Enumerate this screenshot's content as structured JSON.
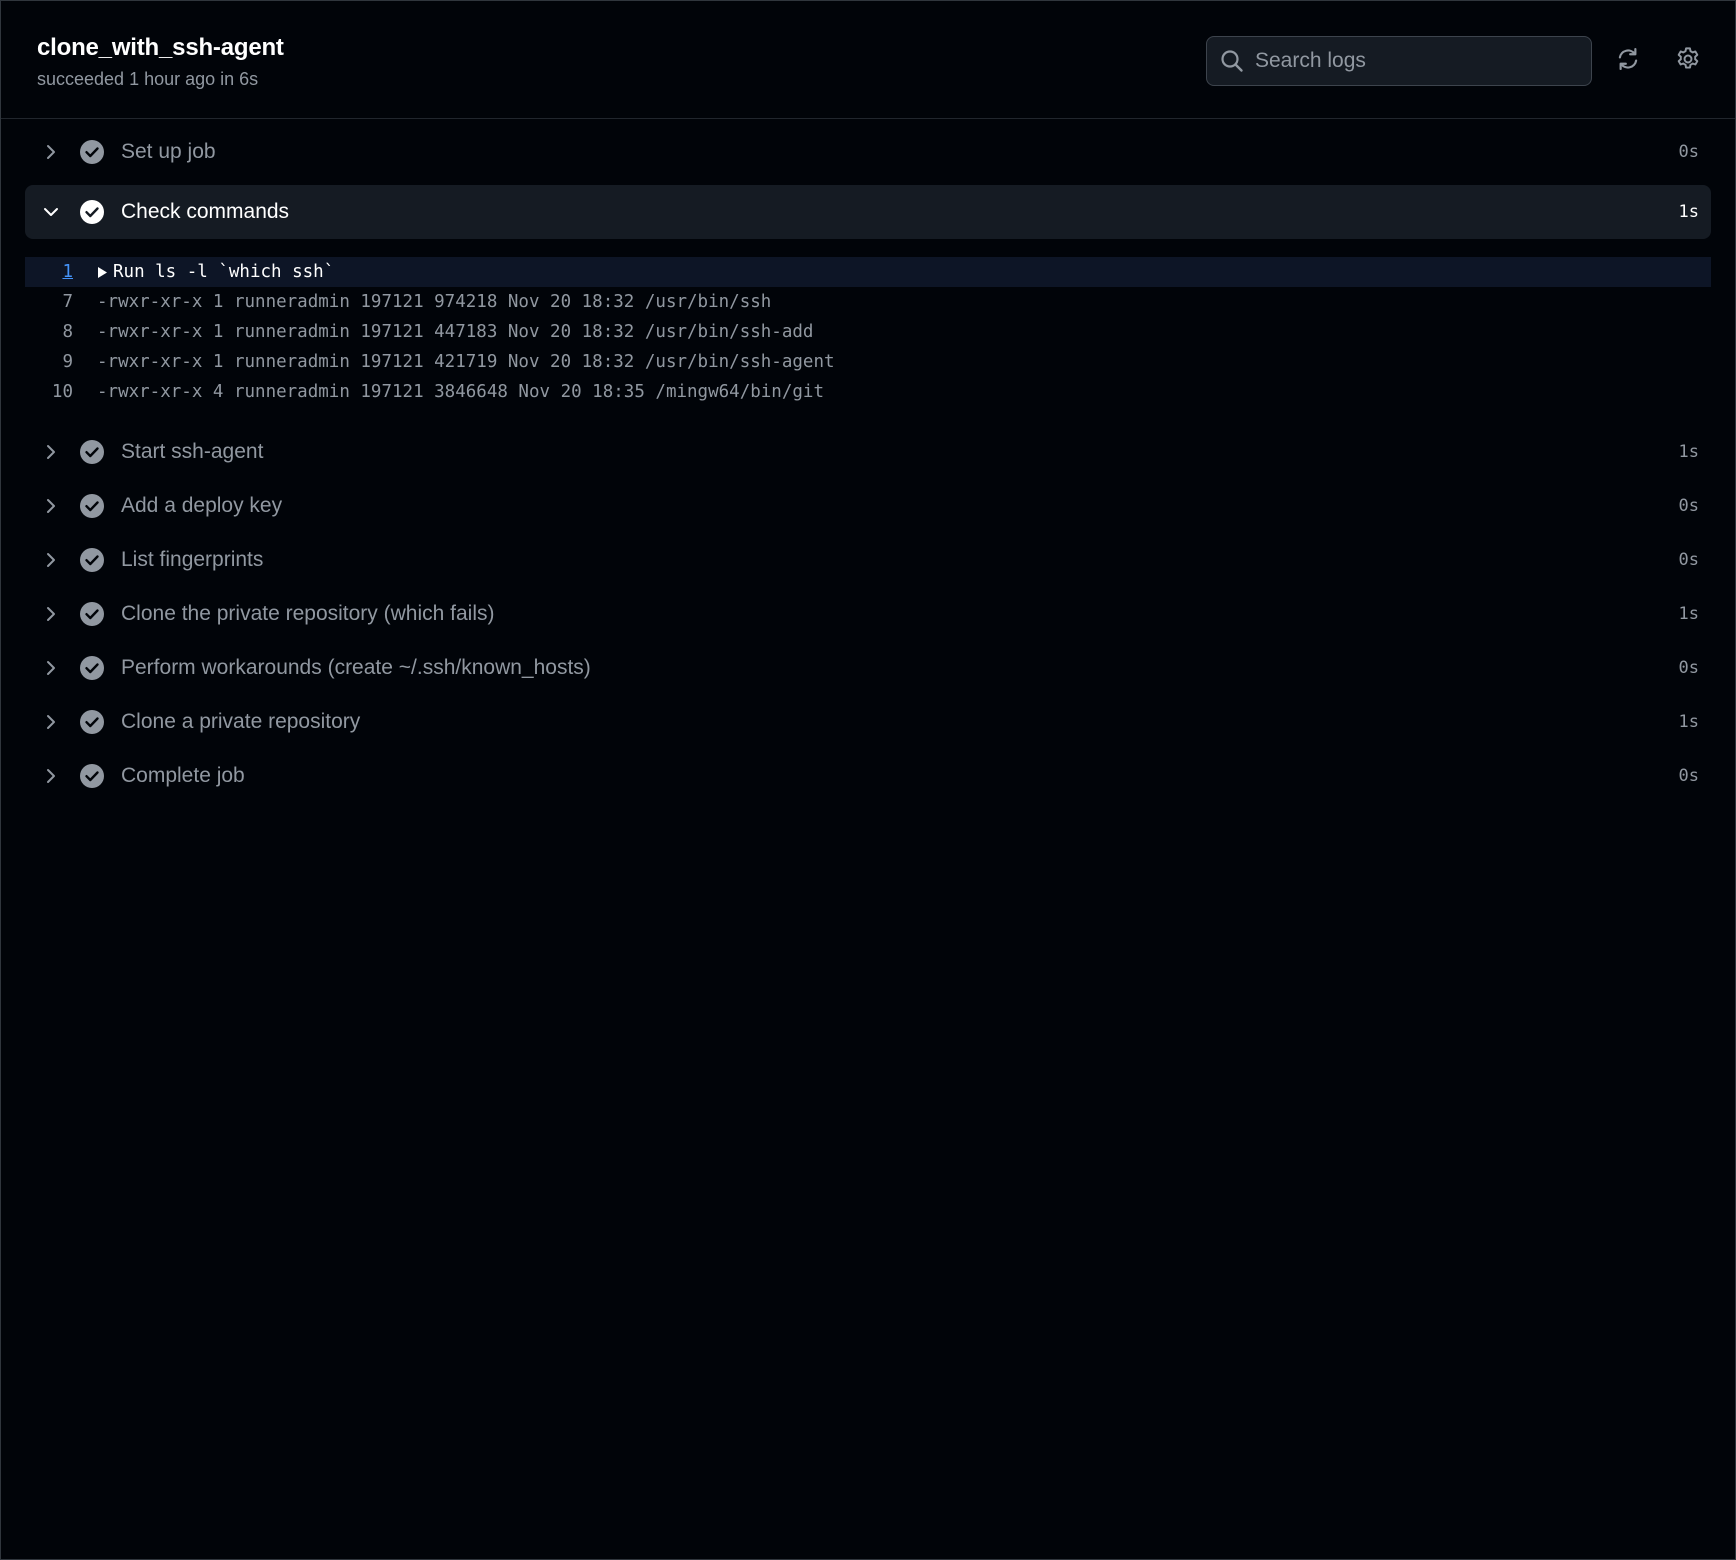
{
  "job": {
    "title": "clone_with_ssh-agent",
    "status": "succeeded 1 hour ago in 6s"
  },
  "search": {
    "placeholder": "Search logs"
  },
  "icons": {
    "search": "search-icon",
    "refresh": "refresh-icon",
    "settings": "gear-icon",
    "chevron_right": "chevron-right-icon",
    "chevron_down": "chevron-down-icon",
    "check": "check-circle-icon",
    "triangle": "triangle-right-icon"
  },
  "colors": {
    "background": "#010409",
    "expanded_row": "#151b23",
    "highlight_line": "#0d1526",
    "muted_text": "#9198a1",
    "link_blue": "#4493f8",
    "check_muted": "#9198a1",
    "check_active": "#ffffff"
  },
  "steps_before": [
    {
      "label": "Set up job",
      "duration": "0s"
    }
  ],
  "expanded_step": {
    "label": "Check commands",
    "duration": "1s",
    "log": [
      {
        "ln": "1",
        "text": "Run ls -l `which ssh`",
        "group": true
      },
      {
        "ln": "7",
        "text": "-rwxr-xr-x 1 runneradmin 197121 974218 Nov 20 18:32 /usr/bin/ssh"
      },
      {
        "ln": "8",
        "text": "-rwxr-xr-x 1 runneradmin 197121 447183 Nov 20 18:32 /usr/bin/ssh-add"
      },
      {
        "ln": "9",
        "text": "-rwxr-xr-x 1 runneradmin 197121 421719 Nov 20 18:32 /usr/bin/ssh-agent"
      },
      {
        "ln": "10",
        "text": "-rwxr-xr-x 4 runneradmin 197121 3846648 Nov 20 18:35 /mingw64/bin/git"
      }
    ]
  },
  "steps_after": [
    {
      "label": "Start ssh-agent",
      "duration": "1s"
    },
    {
      "label": "Add a deploy key",
      "duration": "0s"
    },
    {
      "label": "List fingerprints",
      "duration": "0s"
    },
    {
      "label": "Clone the private repository (which fails)",
      "duration": "1s"
    },
    {
      "label": "Perform workarounds (create ~/.ssh/known_hosts)",
      "duration": "0s"
    },
    {
      "label": "Clone a private repository",
      "duration": "1s"
    },
    {
      "label": "Complete job",
      "duration": "0s"
    }
  ]
}
